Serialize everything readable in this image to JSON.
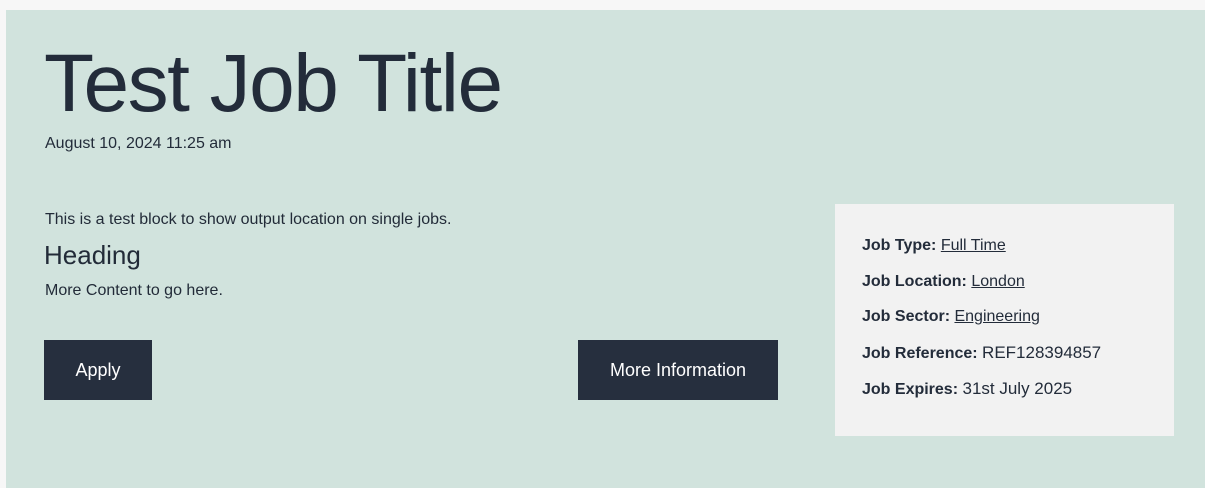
{
  "job": {
    "title": "Test Job Title",
    "posted": "August 10, 2024 11:25 am"
  },
  "content": {
    "intro": "This is a test block to show output location on single jobs.",
    "heading": "Heading",
    "body": "More Content to go here."
  },
  "buttons": {
    "apply": "Apply",
    "more_info": "More Information"
  },
  "details": {
    "type_label": "Job Type:",
    "type_value": "Full Time",
    "location_label": "Job Location:",
    "location_value": "London",
    "sector_label": "Job Sector:",
    "sector_value": "Engineering",
    "reference_label": "Job Reference:",
    "reference_value": "REF128394857",
    "expires_label": "Job Expires:",
    "expires_value": "31st July 2025"
  },
  "colors": {
    "panel_background": "#d1e3dd",
    "details_background": "#f2f2f2",
    "button_background": "#262f3e",
    "text": "#232c3a"
  }
}
